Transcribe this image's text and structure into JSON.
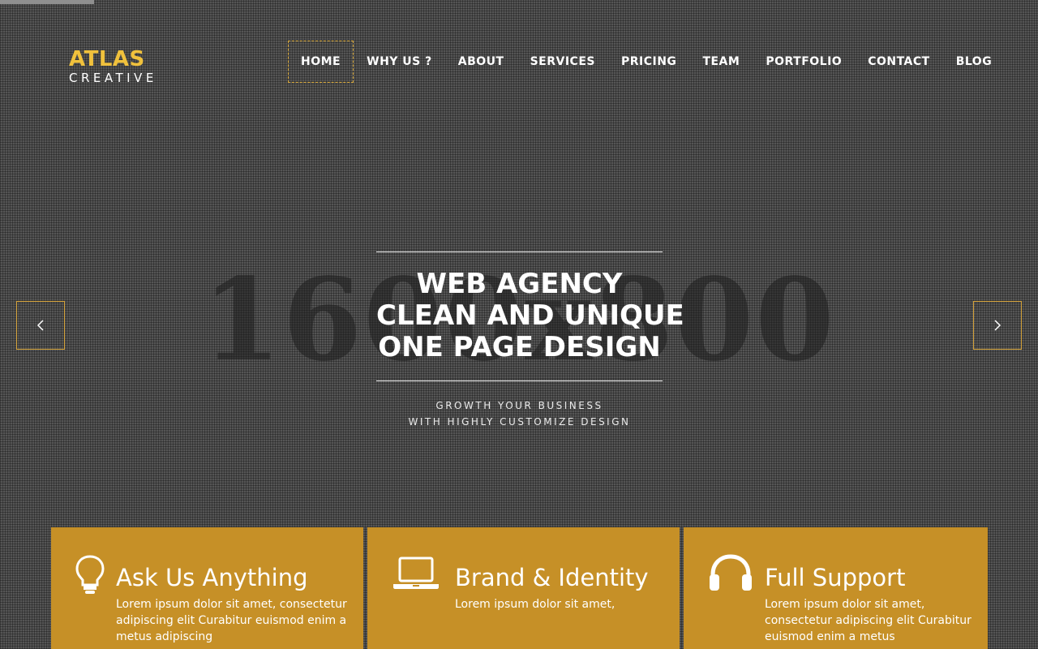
{
  "brand": {
    "name": "ATLAS",
    "tagline": "CREATIVE",
    "accent_color": "#f0c13c",
    "card_color": "#c69027"
  },
  "nav": {
    "items": [
      {
        "label": "HOME",
        "active": true
      },
      {
        "label": "WHY US ?"
      },
      {
        "label": "ABOUT"
      },
      {
        "label": "SERVICES"
      },
      {
        "label": "PRICING"
      },
      {
        "label": "TEAM"
      },
      {
        "label": "PORTFOLIO"
      },
      {
        "label": "CONTACT"
      },
      {
        "label": "BLOG"
      }
    ]
  },
  "hero": {
    "background_text": "1600x800",
    "title_lines": [
      "WEB AGENCY",
      "CLEAN AND UNIQUE",
      "ONE PAGE DESIGN"
    ],
    "subtitle_lines": [
      "GROWTH YOUR BUSINESS",
      "WITH HIGHLY CUSTOMIZE DESIGN"
    ],
    "prev_icon": "chevron-left-icon",
    "next_icon": "chevron-right-icon"
  },
  "features": [
    {
      "icon": "lightbulb-icon",
      "title": "Ask Us Anything",
      "text": "Lorem ipsum dolor sit amet, consectetur adipiscing elit Curabitur euismod enim a metus adipiscing"
    },
    {
      "icon": "laptop-icon",
      "title": "Brand & Identity",
      "text": "Lorem ipsum dolor sit amet,"
    },
    {
      "icon": "headphones-icon",
      "title": "Full Support",
      "text": "Lorem ipsum dolor sit amet, consectetur adipiscing elit Curabitur euismod enim a metus"
    }
  ]
}
